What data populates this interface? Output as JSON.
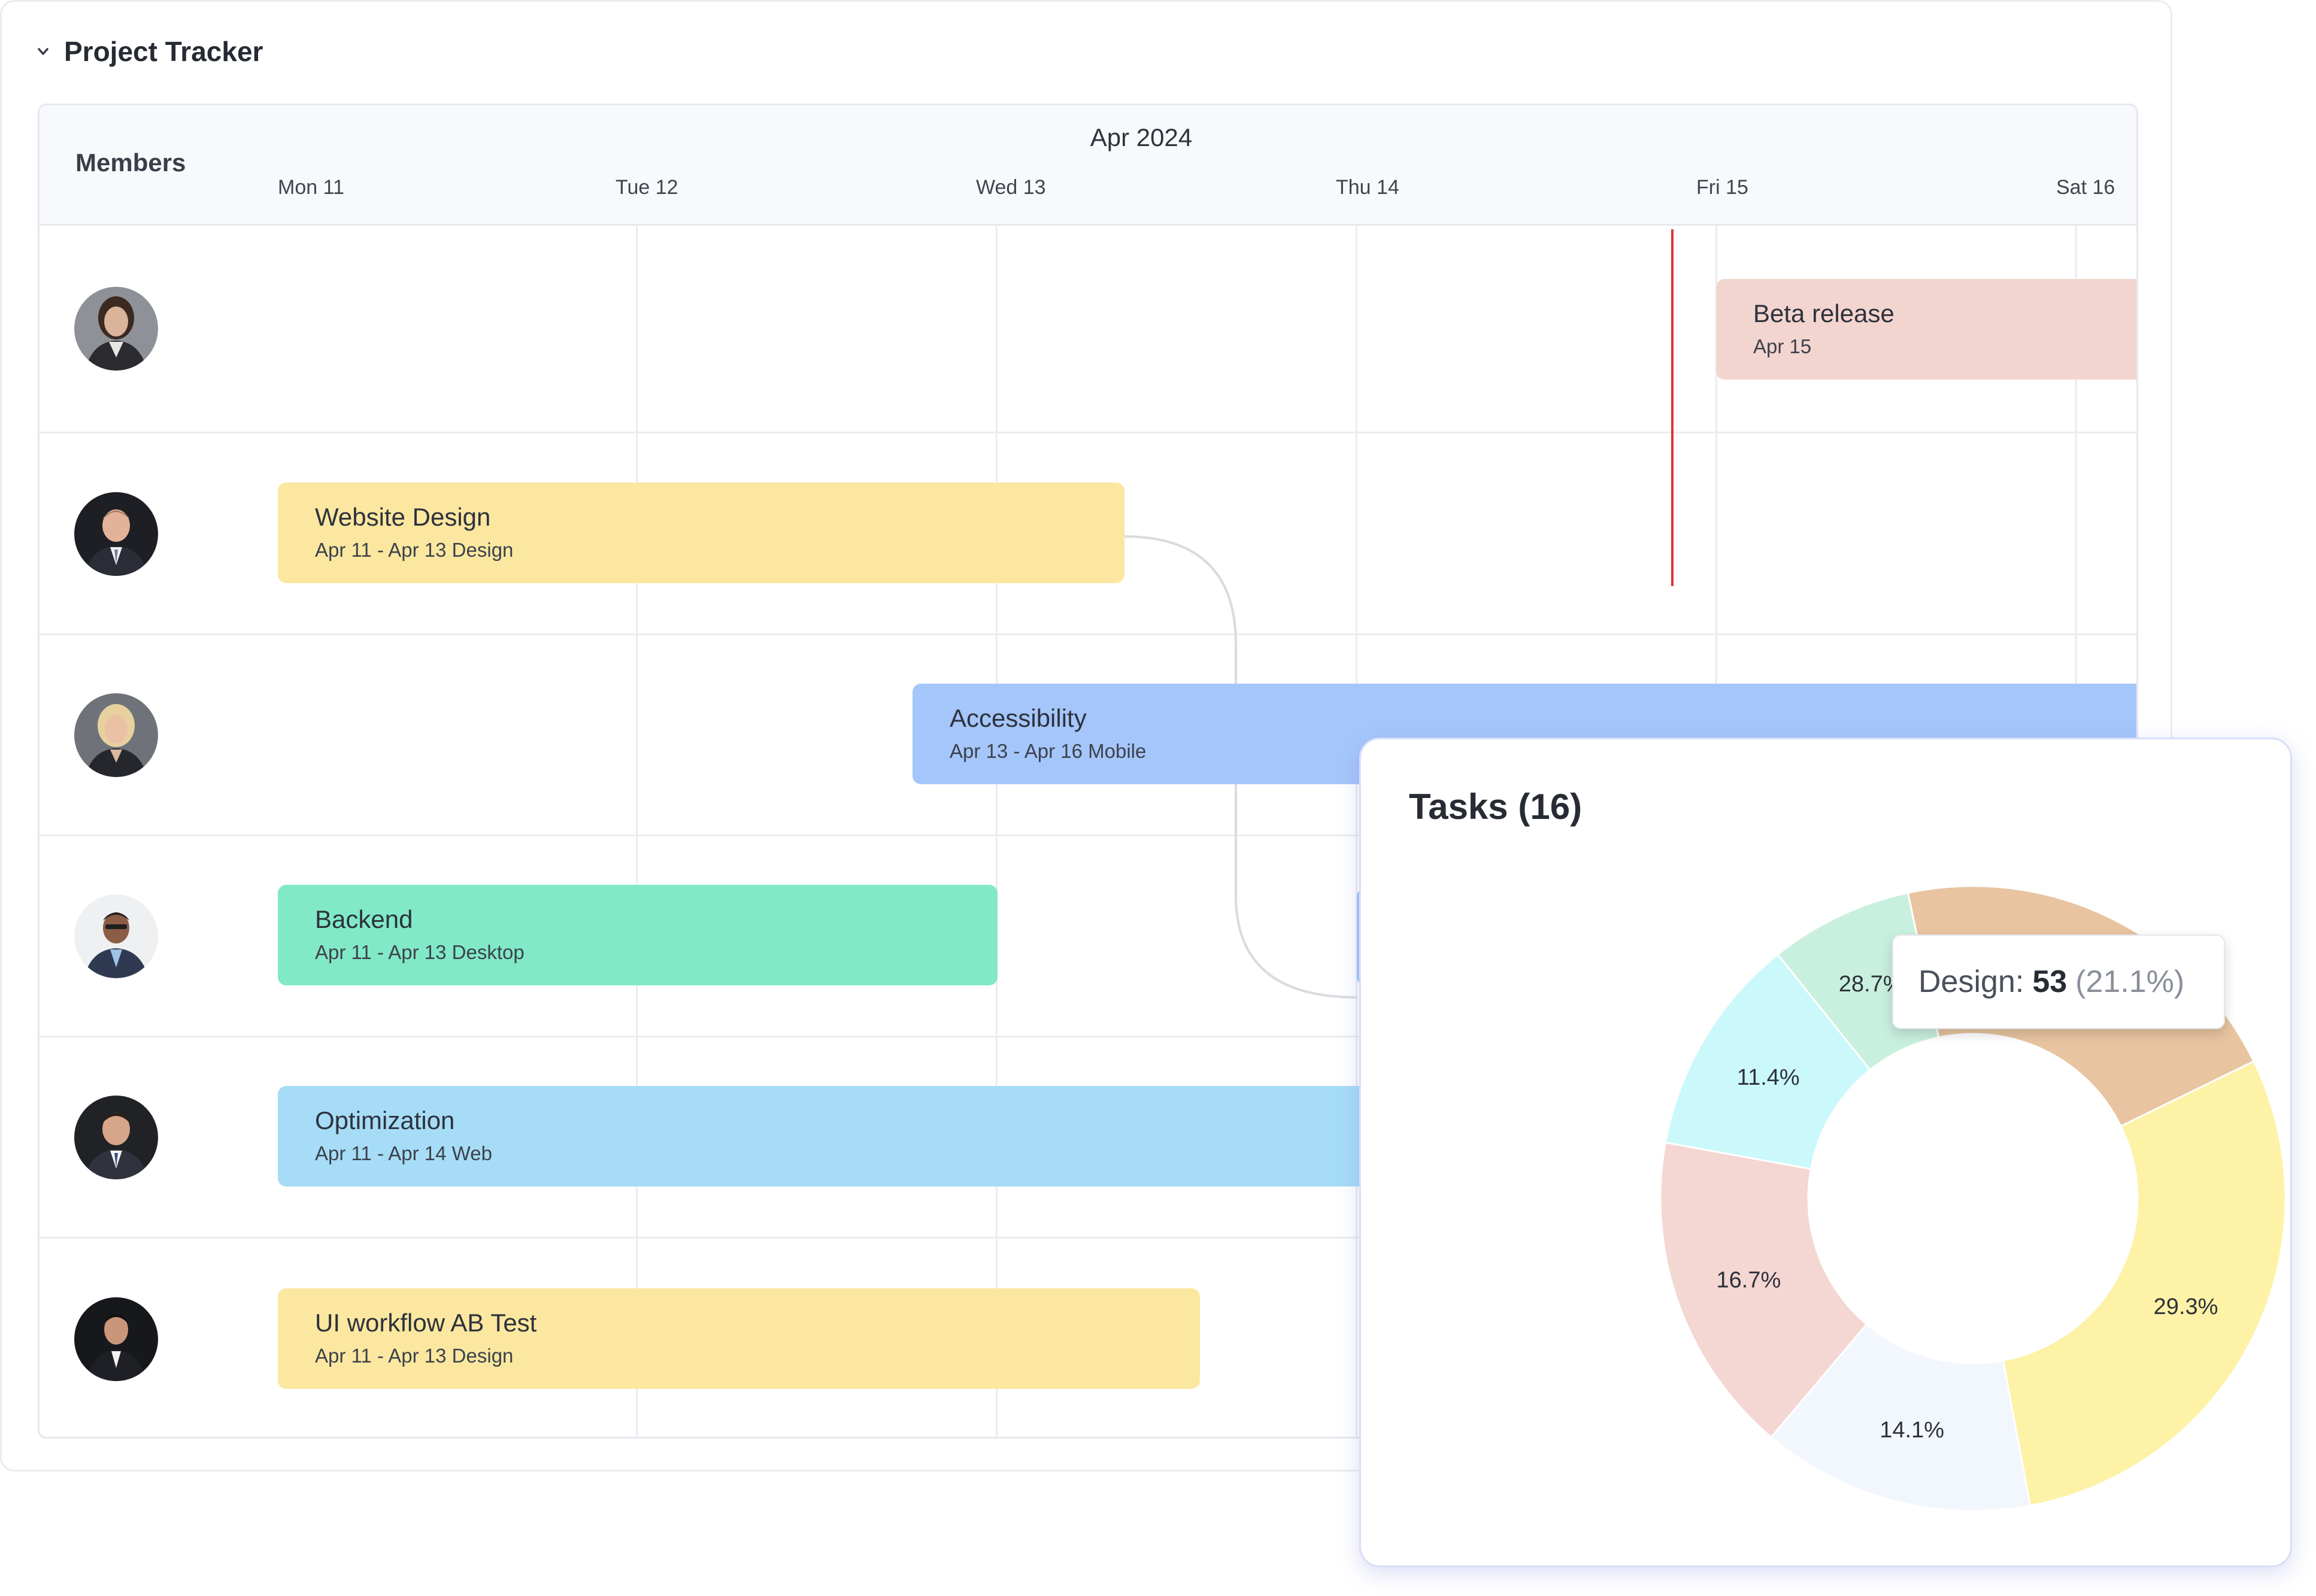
{
  "tracker": {
    "title": "Project Tracker",
    "members_label": "Members",
    "month": "Apr 2024",
    "days": [
      "Mon 11",
      "Tue 12",
      "Wed 13",
      "Thu 14",
      "Fri 15",
      "Sat 16"
    ]
  },
  "tasks": [
    {
      "title": "Beta release",
      "subtitle": "Apr 15",
      "color": "#f3d5cf"
    },
    {
      "title": "Website Design",
      "subtitle": "Apr 11 - Apr 13 Design",
      "color": "#fbe79f"
    },
    {
      "title": "Accessibility",
      "subtitle": "Apr 13 - Apr 16 Mobile",
      "color": "#a5c6fa"
    },
    {
      "title": "Backend",
      "subtitle": "Apr 11 - Apr 13 Desktop",
      "color": "#81e9c6"
    },
    {
      "title": "Optimization",
      "subtitle": "Apr 11 - Apr 14 Web",
      "color": "#a6dcf6"
    },
    {
      "title": "UI workflow AB Test",
      "subtitle": "Apr 11 - Apr 13 Design",
      "color": "#fbe79f"
    }
  ],
  "colors": {
    "today_line": "#d9363e",
    "card_border": "#d9def8"
  },
  "chart_data": {
    "type": "pie",
    "variant": "donut",
    "title": "Tasks (16)",
    "slices": [
      {
        "label_text": "21.1%",
        "value": 21.1,
        "color": "#e8c4a0"
      },
      {
        "label_text": "29.3%",
        "value": 29.3,
        "color": "#fdf2a6"
      },
      {
        "label_text": "14.1%",
        "value": 14.1,
        "color": "#f2f6fd"
      },
      {
        "label_text": "16.7%",
        "value": 16.7,
        "color": "#f4d6d2"
      },
      {
        "label_text": "11.4%",
        "value": 11.4,
        "color": "#cbf9fb"
      },
      {
        "label_text": "28.7%",
        "value": 7.4,
        "color": "#c9f0de"
      }
    ],
    "tooltip": {
      "label": "Design:",
      "value": "53",
      "percent": "(21.1%)"
    }
  }
}
